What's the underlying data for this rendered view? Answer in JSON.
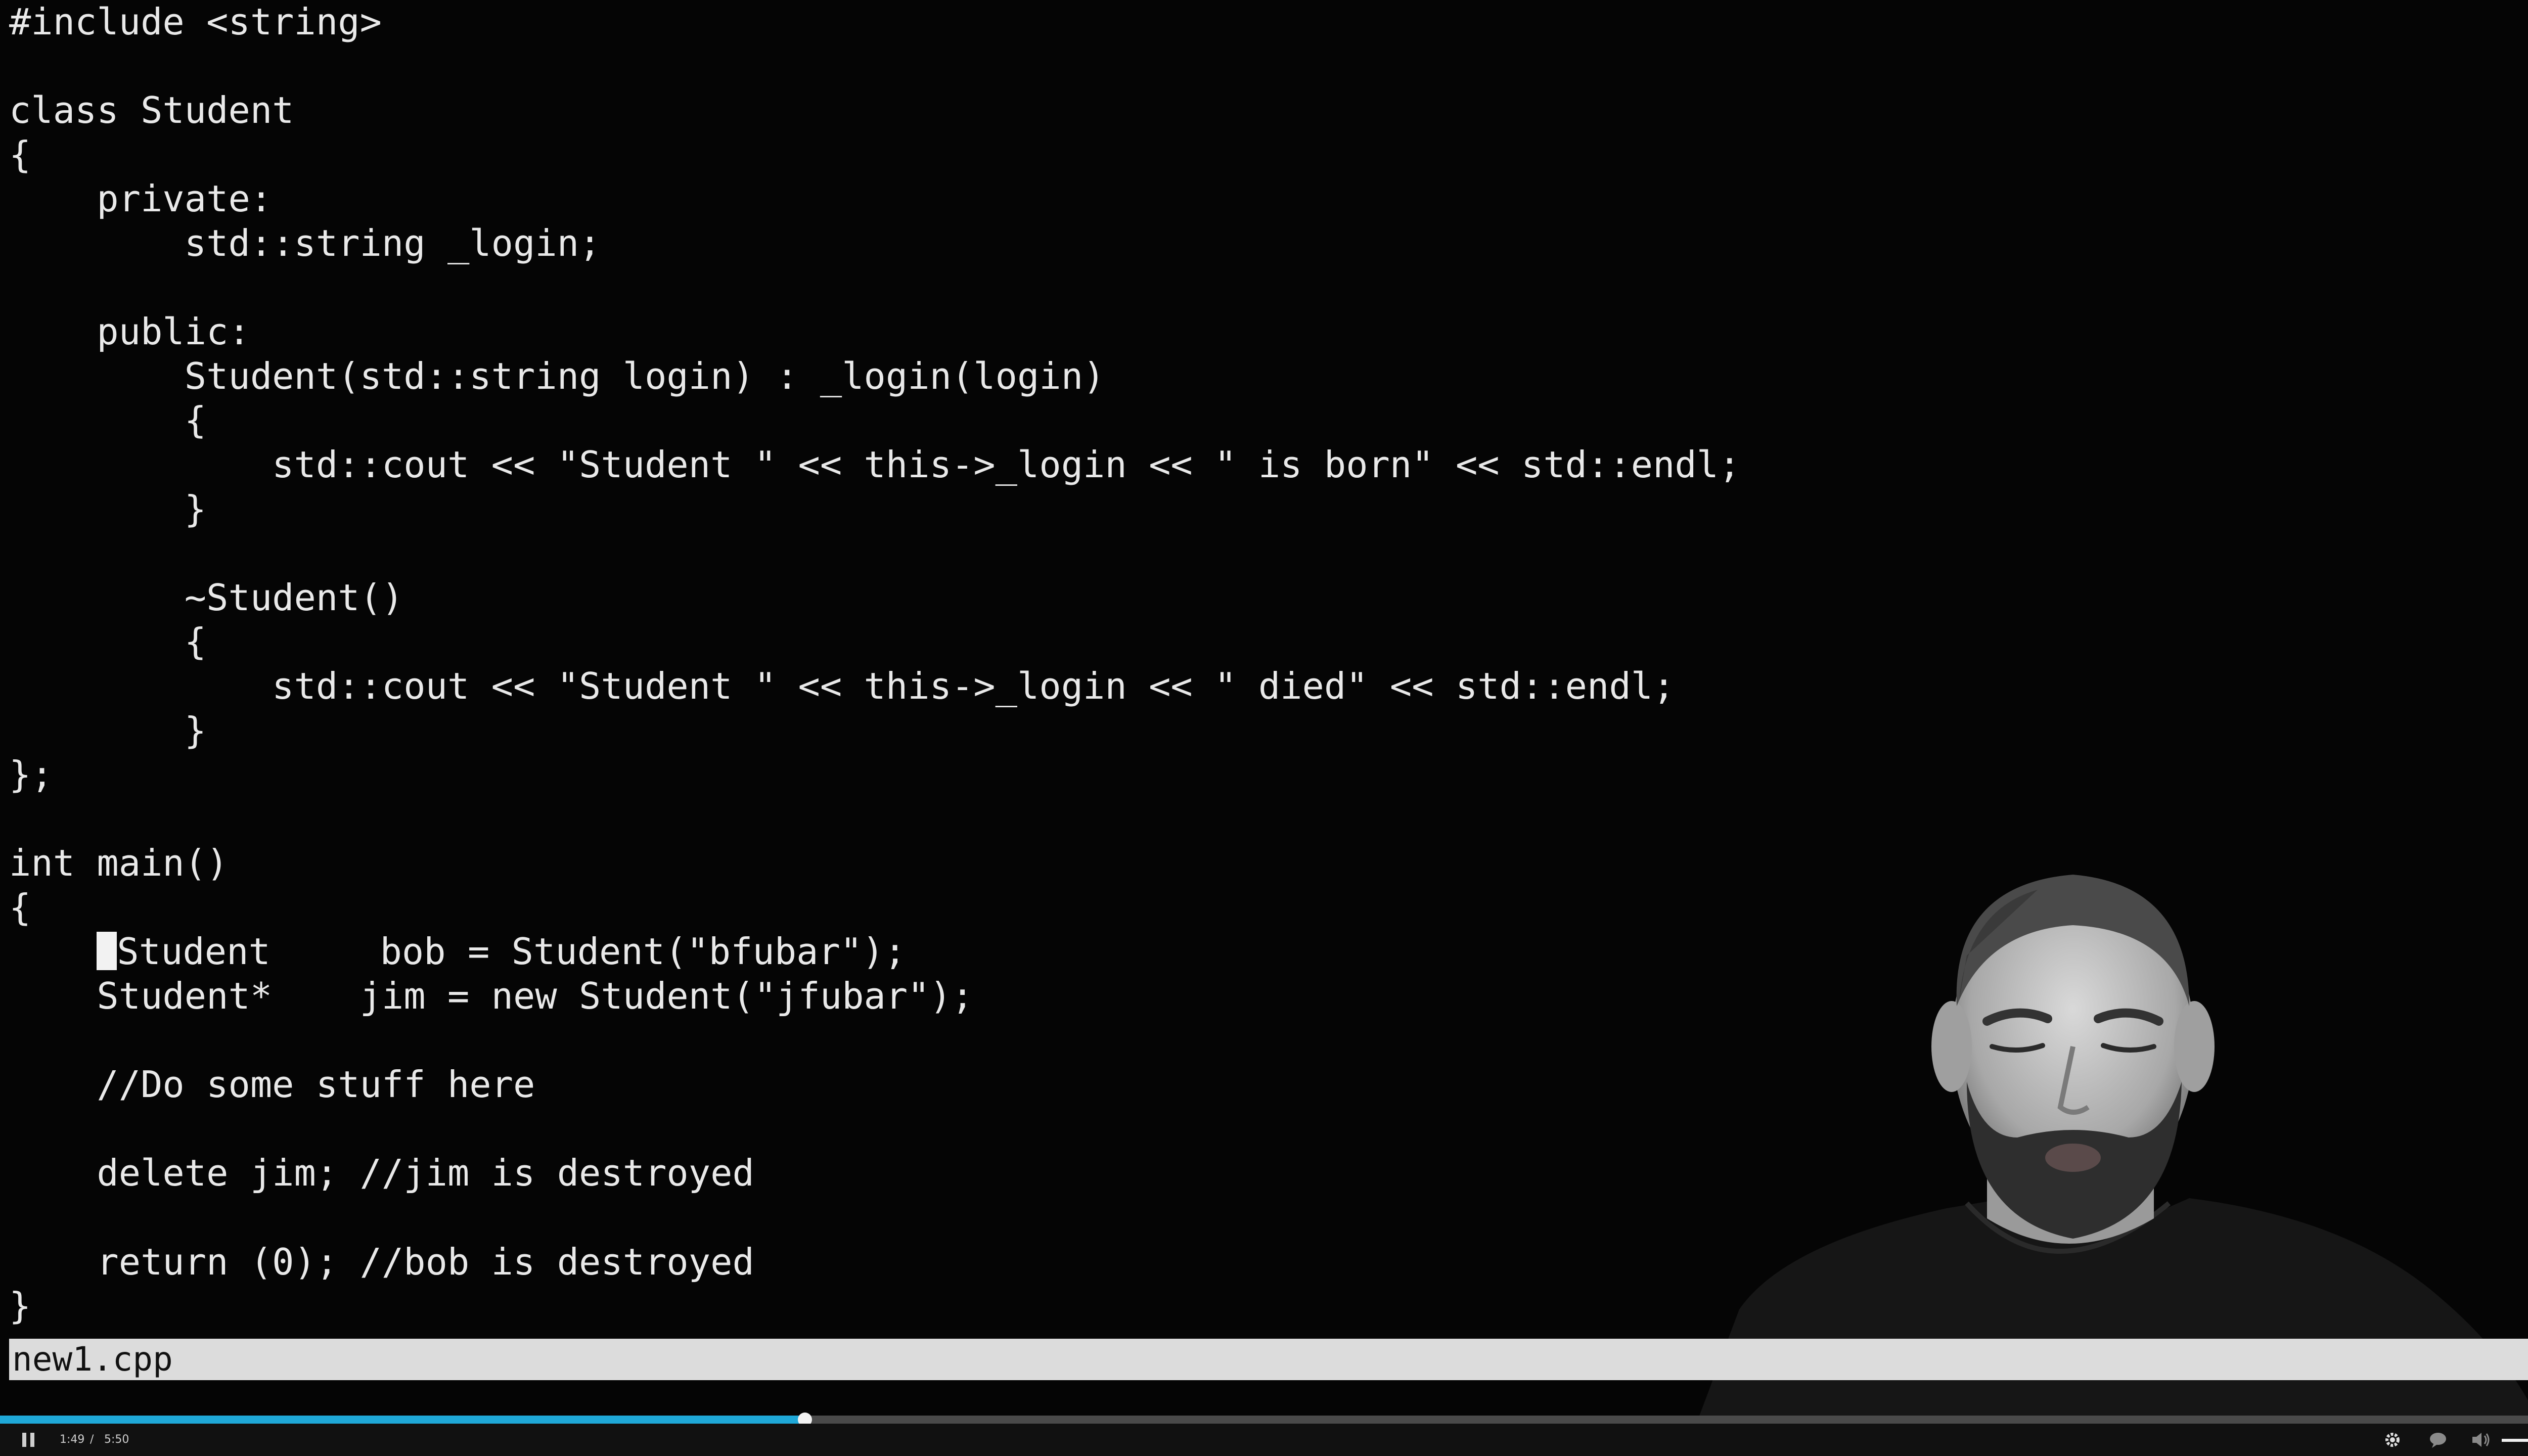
{
  "editor": {
    "filename": "new1.cpp",
    "code_lines": [
      "#include <string>",
      "",
      "class Student",
      "{",
      "    private:",
      "        std::string _login;",
      "",
      "    public:",
      "        Student(std::string login) : _login(login)",
      "        {",
      "            std::cout << \"Student \" << this->_login << \" is born\" << std::endl;",
      "        }",
      "",
      "        ~Student()",
      "        {",
      "            std::cout << \"Student \" << this->_login << \" died\" << std::endl;",
      "        }",
      "};",
      "",
      "int main()",
      "{",
      "    Student     bob = Student(\"bfubar\");",
      "    Student*    jim = new Student(\"jfubar\");",
      "",
      "    //Do some stuff here",
      "",
      "    delete jim; //jim is destroyed",
      "",
      "    return (0); //bob is destroyed",
      "}"
    ],
    "cursor_line": 21,
    "cursor_col": 4
  },
  "player": {
    "time_current": "1:49",
    "time_separator": "/",
    "time_total": "5:50",
    "progress_fraction": 0.311,
    "volume_fraction": 0.75,
    "icons": {
      "pause": "pause-icon",
      "settings": "gear-icon",
      "captions": "captions-icon",
      "volume": "volume-icon",
      "fullscreen": "fullscreen-icon"
    }
  },
  "colors": {
    "background": "#050505",
    "code_text": "#e9e9e9",
    "status_bar": "#dcdcdc",
    "progress_accent": "#1fa8d8"
  }
}
